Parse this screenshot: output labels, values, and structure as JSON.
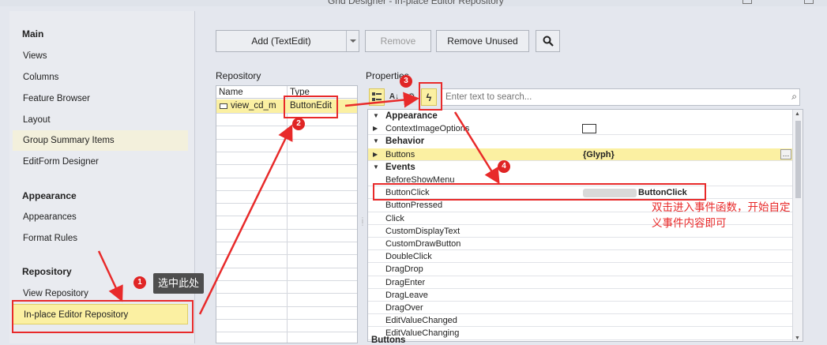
{
  "window": {
    "title": "Grid Designer - In-place Editor Repository"
  },
  "sidebar": {
    "groups": [
      {
        "title": "Main",
        "items": [
          "Views",
          "Columns",
          "Feature Browser",
          "Layout",
          "Group Summary Items",
          "EditForm Designer"
        ]
      },
      {
        "title": "Appearance",
        "items": [
          "Appearances",
          "Format Rules"
        ]
      },
      {
        "title": "Repository",
        "items": [
          "View Repository",
          "In-place Editor Repository"
        ]
      }
    ]
  },
  "toolbar": {
    "add_label": "Add (TextEdit)",
    "remove_label": "Remove",
    "remove_unused_label": "Remove Unused",
    "search_icon": "magnifier-icon"
  },
  "repository": {
    "label": "Repository",
    "columns": [
      "Name",
      "Type"
    ],
    "rows": [
      {
        "name": "view_cd_m",
        "type": "ButtonEdit"
      }
    ]
  },
  "properties": {
    "label": "Properties",
    "search_placeholder": "Enter text to search...",
    "rows": [
      {
        "kind": "cat",
        "name": "Appearance"
      },
      {
        "kind": "prop",
        "name": "ContextImageOptions",
        "value": ""
      },
      {
        "kind": "cat",
        "name": "Behavior"
      },
      {
        "kind": "prop",
        "name": "Buttons",
        "value": "{Glyph}"
      },
      {
        "kind": "cat",
        "name": "Events"
      },
      {
        "kind": "prop",
        "name": "BeforeShowMenu",
        "value": ""
      },
      {
        "kind": "prop",
        "name": "ButtonClick",
        "value": "ButtonClick"
      },
      {
        "kind": "prop",
        "name": "ButtonPressed",
        "value": ""
      },
      {
        "kind": "prop",
        "name": "Click",
        "value": ""
      },
      {
        "kind": "prop",
        "name": "CustomDisplayText",
        "value": ""
      },
      {
        "kind": "prop",
        "name": "CustomDrawButton",
        "value": ""
      },
      {
        "kind": "prop",
        "name": "DoubleClick",
        "value": ""
      },
      {
        "kind": "prop",
        "name": "DragDrop",
        "value": ""
      },
      {
        "kind": "prop",
        "name": "DragEnter",
        "value": ""
      },
      {
        "kind": "prop",
        "name": "DragLeave",
        "value": ""
      },
      {
        "kind": "prop",
        "name": "DragOver",
        "value": ""
      },
      {
        "kind": "prop",
        "name": "EditValueChanged",
        "value": ""
      },
      {
        "kind": "prop",
        "name": "EditValueChanging",
        "value": ""
      }
    ],
    "footer": "Buttons"
  },
  "annotations": {
    "badges": [
      "1",
      "2",
      "3",
      "4"
    ],
    "tooltip": "选中此处",
    "note_line1": "双击进入事件函数，开始自定",
    "note_line2": "义事件内容即可"
  },
  "colors": {
    "highlight": "#fbf0a2",
    "annotation_red": "#e82a2a",
    "background": "#e4e7ee"
  }
}
